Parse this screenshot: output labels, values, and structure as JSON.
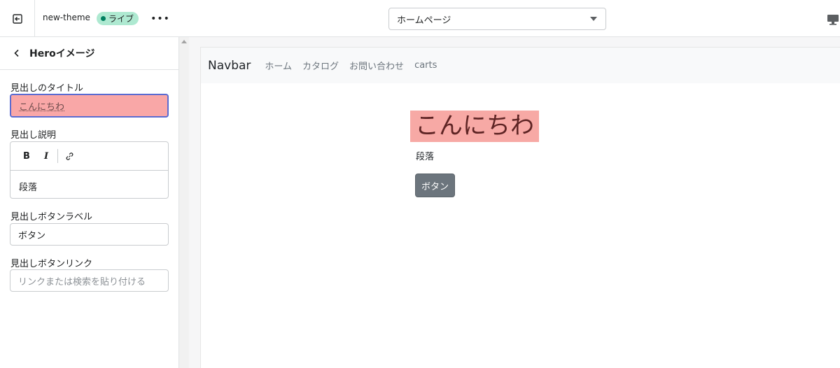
{
  "topbar": {
    "theme_name": "new-theme",
    "live_badge": "ライブ",
    "more_label": "•••",
    "page_select_value": "ホームページ"
  },
  "sidebar": {
    "title": "Heroイメージ",
    "fields": {
      "heading_title": {
        "label": "見出しのタイトル",
        "value": "こんにちわ"
      },
      "heading_description": {
        "label": "見出し説明",
        "bold": "B",
        "italic": "I",
        "value": "段落"
      },
      "button_label": {
        "label": "見出しボタンラベル",
        "value": "ボタン"
      },
      "button_link": {
        "label": "見出しボタンリンク",
        "placeholder": "リンクまたは検索を貼り付ける"
      }
    }
  },
  "preview": {
    "navbar": {
      "brand": "Navbar",
      "links": [
        "ホーム",
        "カタログ",
        "お問い合わせ",
        "carts"
      ]
    },
    "hero": {
      "title": "こんにちわ",
      "text": "段落",
      "button": "ボタン"
    }
  },
  "colors": {
    "live_badge_bg": "#aee9d1",
    "live_dot": "#007f5f",
    "highlight_bg": "#f9a7a7",
    "focus_border": "#5b6bd1",
    "hero_title_bg": "#f7a9a5",
    "hero_button_bg": "#6c757d"
  }
}
